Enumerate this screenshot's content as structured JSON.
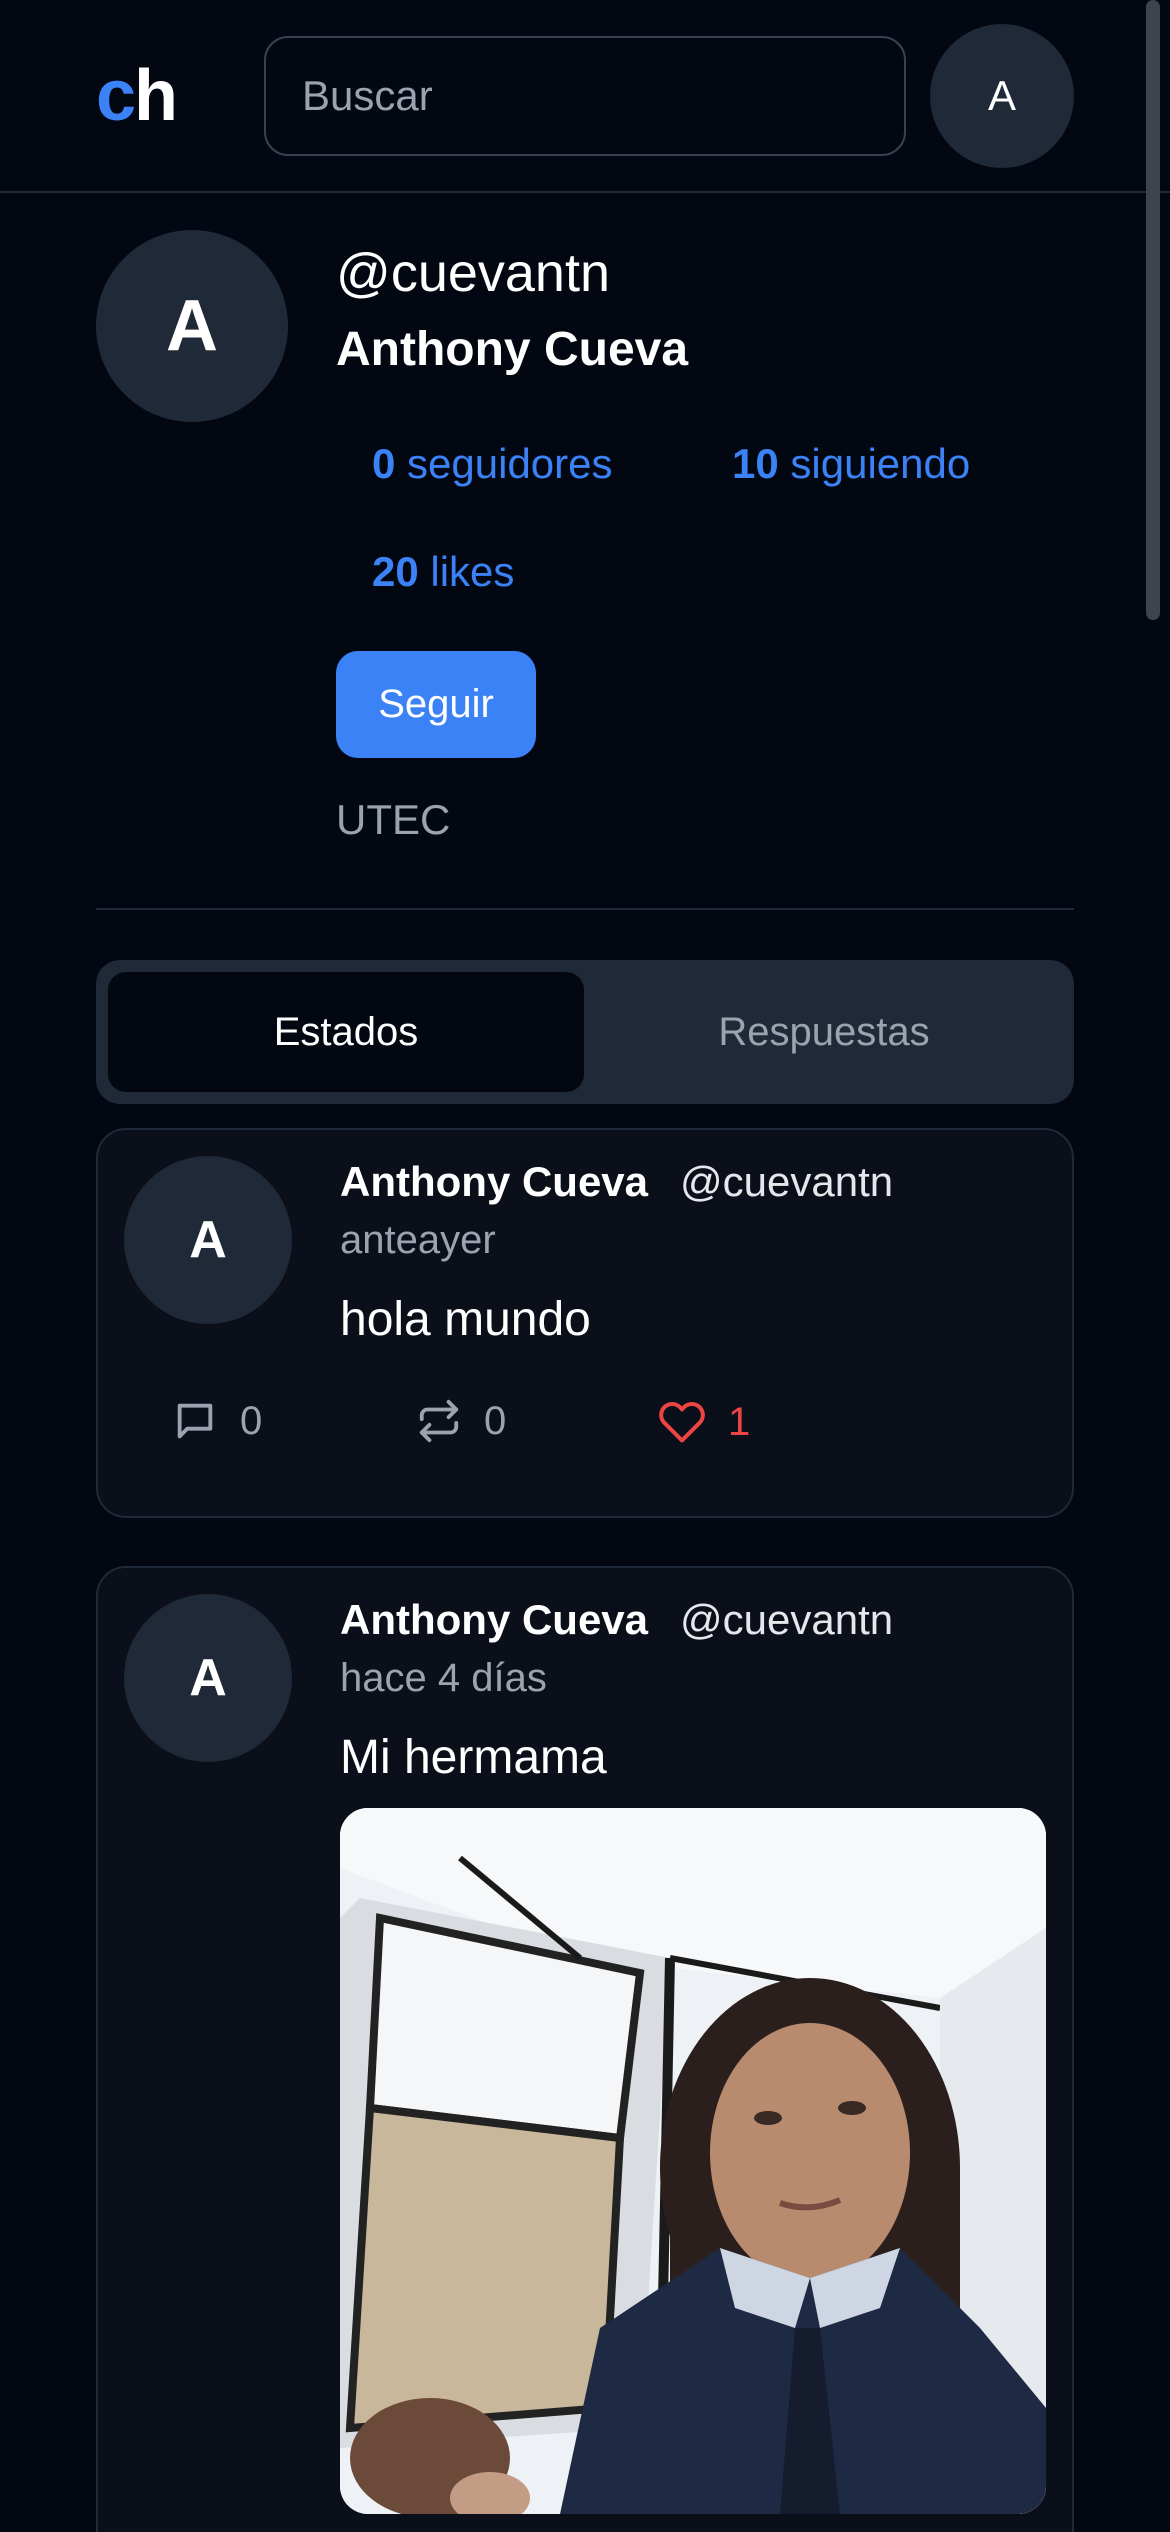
{
  "header": {
    "logo_c": "c",
    "logo_h": "h",
    "search_placeholder": "Buscar",
    "avatar_initial": "A"
  },
  "profile": {
    "avatar_initial": "A",
    "handle": "@cuevantn",
    "name": "Anthony Cueva",
    "followers_count": "0",
    "followers_label": "seguidores",
    "following_count": "10",
    "following_label": "siguiendo",
    "likes_count": "20",
    "likes_label": "likes",
    "follow_label": "Seguir",
    "bio": "UTEC"
  },
  "tabs": [
    {
      "label": "Estados",
      "active": true
    },
    {
      "label": "Respuestas",
      "active": false
    }
  ],
  "posts": [
    {
      "avatar_initial": "A",
      "name": "Anthony Cueva",
      "handle": "@cuevantn",
      "time": "anteayer",
      "text": "hola mundo",
      "replies": "0",
      "reposts": "0",
      "likes": "1"
    },
    {
      "avatar_initial": "A",
      "name": "Anthony Cueva",
      "handle": "@cuevantn",
      "time": "hace 4 días",
      "text": "Mi hermama"
    }
  ],
  "colors": {
    "background": "#030712",
    "accent": "#3b82f6",
    "like": "#ef4444",
    "surface": "#1f2937"
  }
}
